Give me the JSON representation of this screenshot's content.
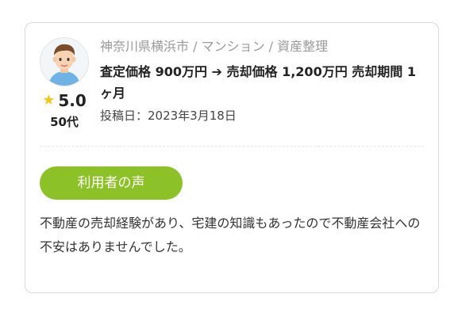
{
  "review": {
    "location_type": "神奈川県横浜市 / マンション / 資産整理",
    "headline": "査定価格 900万円 ➔ 売却価格 1,200万円 売却期間 1ヶ月",
    "posted": "投稿日：2023年3月18日",
    "rating": "5.0",
    "age": "50代",
    "badge_label": "利用者の声",
    "comment": "不動産の売却経験があり、宅建の知識もあったので不動産会社への不安はありませんでした。"
  },
  "colors": {
    "badge_green": "#8cc227",
    "star_yellow": "#f5c518"
  },
  "icons": {
    "avatar": "man-avatar-icon",
    "star": "star-icon"
  }
}
